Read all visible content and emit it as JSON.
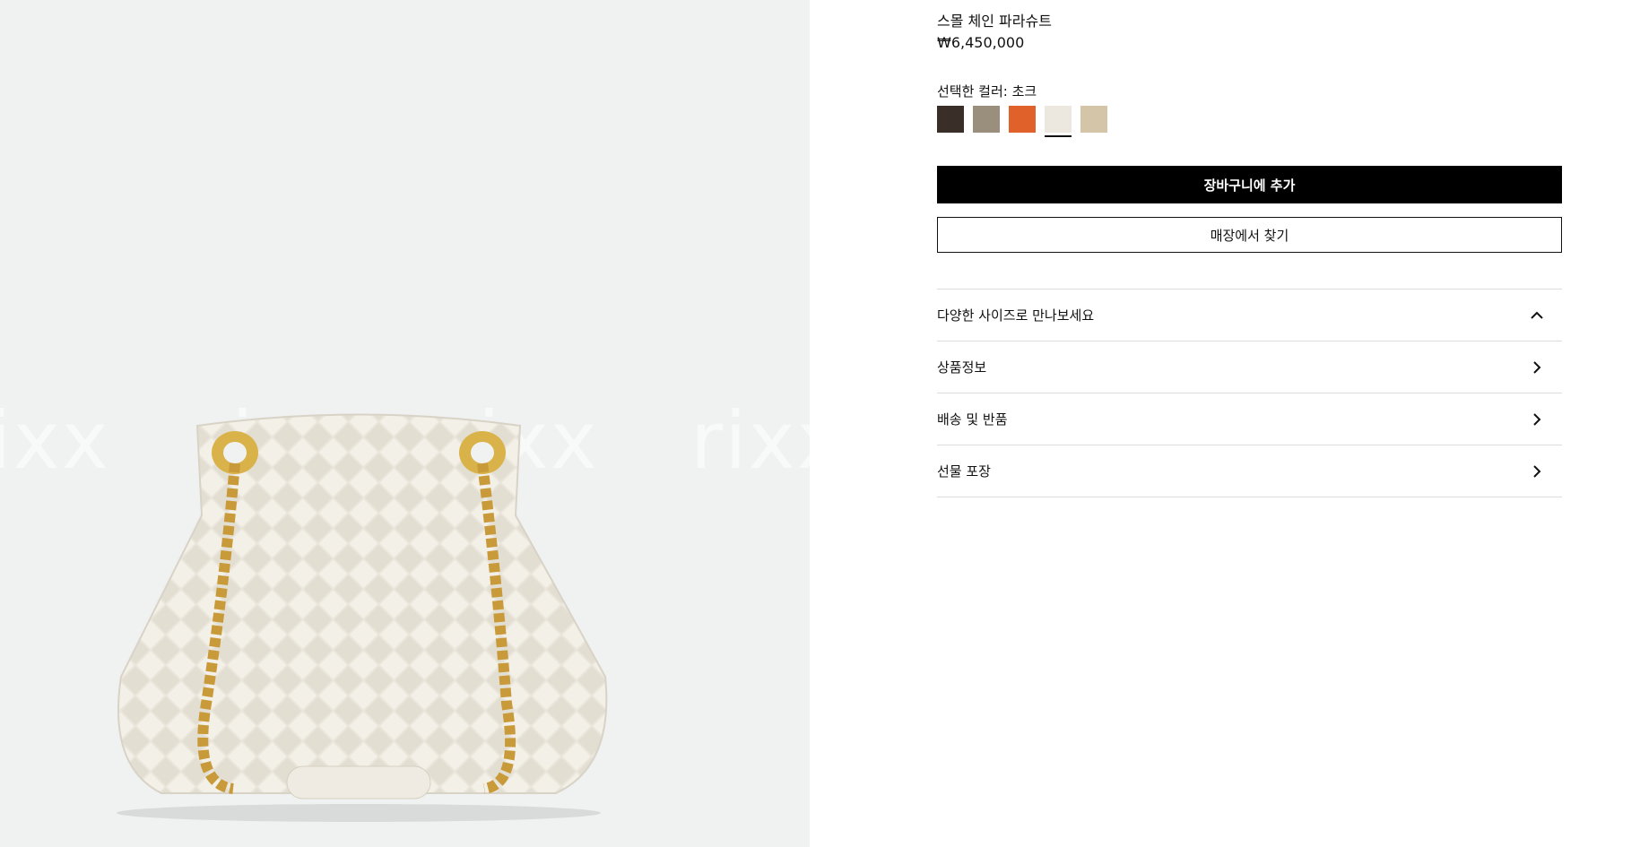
{
  "product": {
    "name": "스몰 체인 파라슈트",
    "price": "₩6,450,000"
  },
  "colors": {
    "label": "선택한 컬러: 초크",
    "swatches": [
      {
        "name": "dark-brown",
        "color": "#3a2e28"
      },
      {
        "name": "taupe",
        "color": "#9a8f7c"
      },
      {
        "name": "orange",
        "color": "#e0612a"
      },
      {
        "name": "chalk",
        "color": "#ece8df",
        "selected": true
      },
      {
        "name": "sand",
        "color": "#d4c5a8"
      }
    ]
  },
  "buttons": {
    "add_to_cart": "장바구니에 추가",
    "find_in_store": "매장에서 찾기"
  },
  "accordion": [
    {
      "label": "다양한 사이즈로 만나보세요",
      "icon": "chevron-up-icon"
    },
    {
      "label": "상품정보",
      "icon": "chevron-right-icon"
    },
    {
      "label": "배송 및 반품",
      "icon": "chevron-right-icon"
    },
    {
      "label": "선물 포장",
      "icon": "chevron-right-icon"
    }
  ],
  "watermark": [
    "rixx",
    "rixx",
    "rixx",
    "rixx"
  ]
}
